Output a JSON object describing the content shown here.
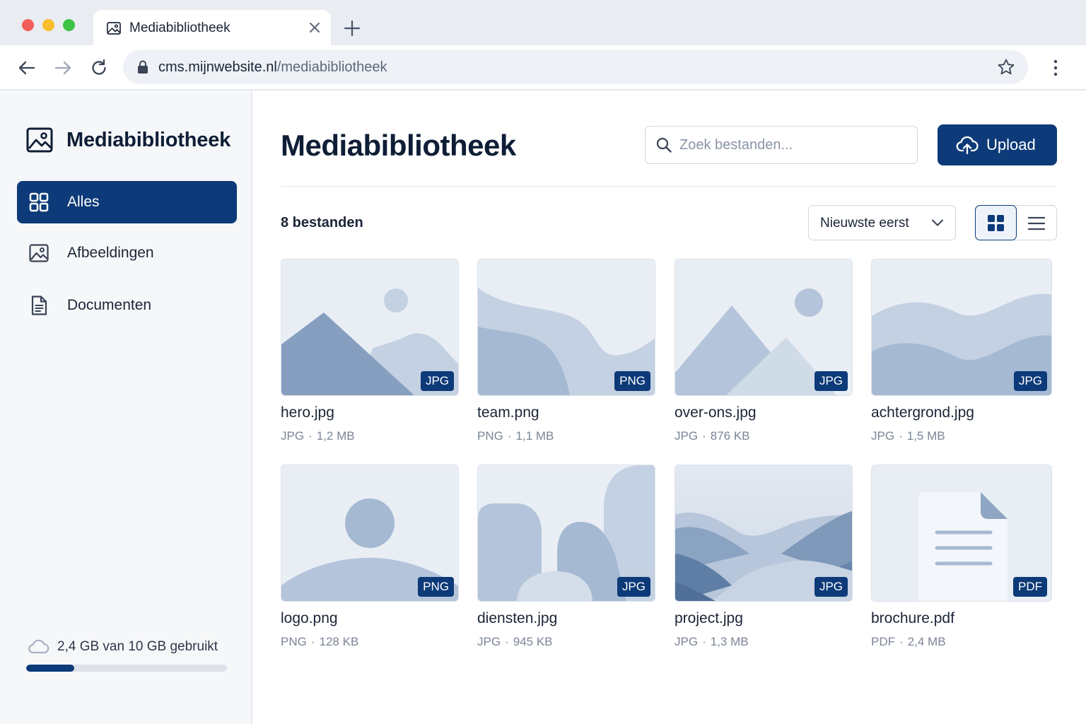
{
  "browser": {
    "tab_title": "Mediabibliotheek",
    "url_host": "cms.mijnwebsite.nl",
    "url_path": "/mediabibliotheek"
  },
  "sidebar": {
    "title": "Mediabibliotheek",
    "items": [
      {
        "label": "Alles",
        "icon": "grid-icon",
        "active": true
      },
      {
        "label": "Afbeeldingen",
        "icon": "image-icon",
        "active": false
      },
      {
        "label": "Documenten",
        "icon": "document-icon",
        "active": false
      }
    ],
    "storage": {
      "label": "2,4 GB van 10 GB gebruikt",
      "used_fraction": 0.24
    }
  },
  "header": {
    "title": "Mediabibliotheek",
    "search_placeholder": "Zoek bestanden...",
    "upload_label": "Upload"
  },
  "toolbar": {
    "file_count": "8 bestanden",
    "sort_label": "Nieuwste eerst",
    "view_mode": "grid"
  },
  "files": [
    {
      "name": "hero.jpg",
      "type": "JPG",
      "size": "1,2 MB"
    },
    {
      "name": "team.png",
      "type": "PNG",
      "size": "1,1 MB"
    },
    {
      "name": "over-ons.jpg",
      "type": "JPG",
      "size": "876 KB"
    },
    {
      "name": "achtergrond.jpg",
      "type": "JPG",
      "size": "1,5 MB"
    },
    {
      "name": "logo.png",
      "type": "PNG",
      "size": "128 KB"
    },
    {
      "name": "diensten.jpg",
      "type": "JPG",
      "size": "945 KB"
    },
    {
      "name": "project.jpg",
      "type": "JPG",
      "size": "1,3 MB"
    },
    {
      "name": "brochure.pdf",
      "type": "PDF",
      "size": "2,4 MB"
    }
  ],
  "colors": {
    "primary": "#0d3a78",
    "thumb_bg": "#e9eef5",
    "thumb_shape_light": "#c4d1e2",
    "thumb_shape_mid": "#a5b9d3",
    "thumb_shape_dark": "#869fc0"
  }
}
